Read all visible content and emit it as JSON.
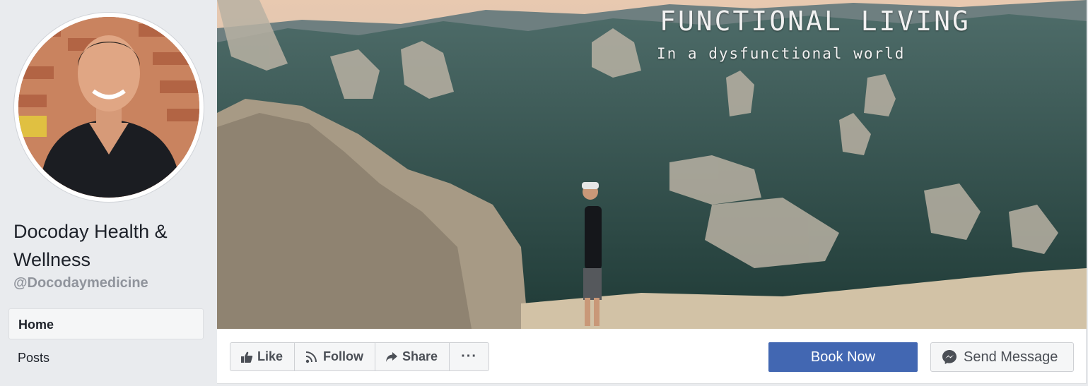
{
  "profile": {
    "name": "Docoday Health & Wellness",
    "handle": "@Docodaymedicine"
  },
  "nav": {
    "items": [
      {
        "label": "Home",
        "active": true
      },
      {
        "label": "Posts",
        "active": false
      }
    ]
  },
  "cover": {
    "title": "FUNCTIONAL LIVING",
    "subtitle": "In a dysfunctional world"
  },
  "actions": {
    "like_label": "Like",
    "follow_label": "Follow",
    "share_label": "Share",
    "more_label": "···",
    "book_label": "Book Now",
    "message_label": "Send Message"
  },
  "colors": {
    "primary_button": "#4267b2",
    "sidebar_bg": "#e9ebee",
    "secondary_text": "#90949c"
  },
  "icons": [
    "like-icon",
    "follow-rss-icon",
    "share-icon",
    "more-icon",
    "messenger-icon"
  ]
}
